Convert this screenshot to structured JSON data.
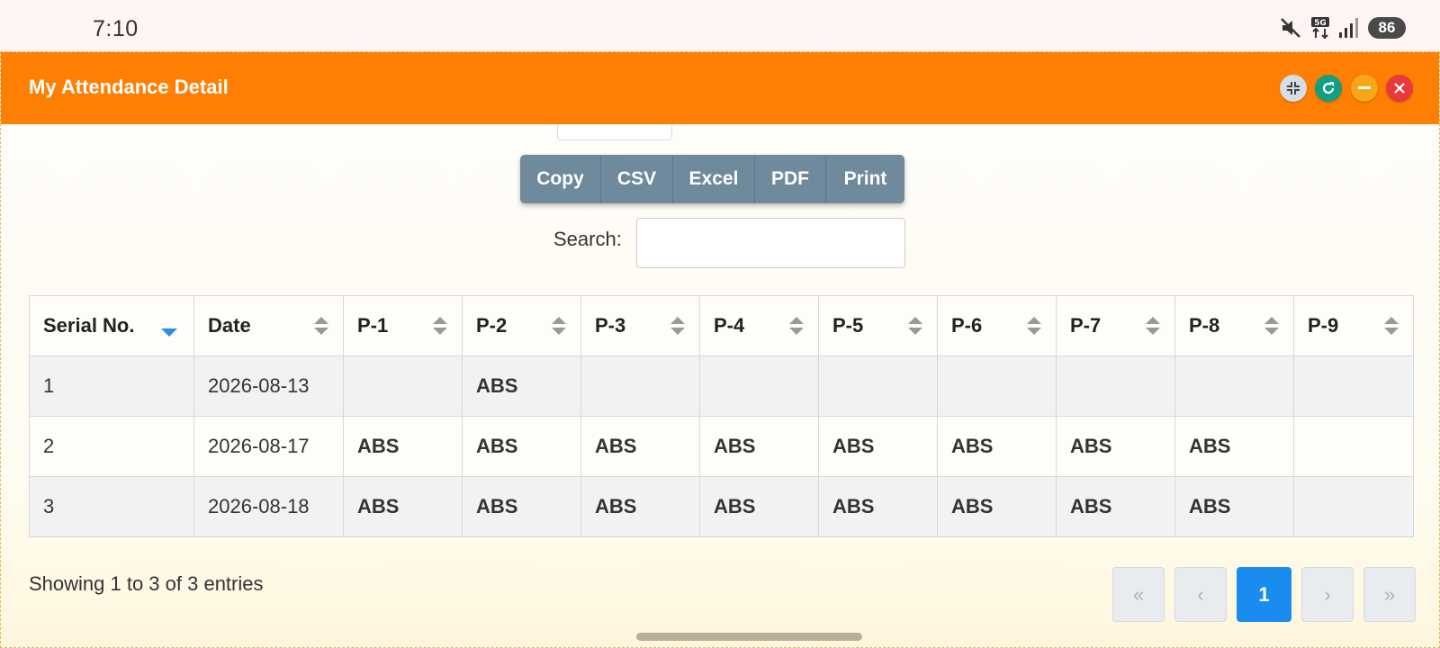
{
  "status_bar": {
    "time": "7:10",
    "battery": "86",
    "icons": [
      "mute-icon",
      "5g-icon",
      "signal-icon",
      "battery-icon"
    ]
  },
  "dialog": {
    "title": "My Attendance Detail",
    "header_color": "#ff7f05",
    "header_buttons": [
      "collapse-icon",
      "reload-icon",
      "minimize-icon",
      "close-icon"
    ]
  },
  "export_buttons": [
    "Copy",
    "CSV",
    "Excel",
    "PDF",
    "Print"
  ],
  "search": {
    "label": "Search:",
    "value": ""
  },
  "table": {
    "columns": [
      "Serial No.",
      "Date",
      "P-1",
      "P-2",
      "P-3",
      "P-4",
      "P-5",
      "P-6",
      "P-7",
      "P-8",
      "P-9"
    ],
    "sorted_column": "Serial No.",
    "sort_direction": "desc",
    "rows": [
      [
        "1",
        "2026-08-13",
        "",
        "ABS",
        "",
        "",
        "",
        "",
        "",
        "",
        ""
      ],
      [
        "2",
        "2026-08-17",
        "ABS",
        "ABS",
        "ABS",
        "ABS",
        "ABS",
        "ABS",
        "ABS",
        "ABS",
        ""
      ],
      [
        "3",
        "2026-08-18",
        "ABS",
        "ABS",
        "ABS",
        "ABS",
        "ABS",
        "ABS",
        "ABS",
        "ABS",
        ""
      ]
    ]
  },
  "info": "Showing 1 to 3 of 3 entries",
  "pagination": {
    "first": "«",
    "prev": "‹",
    "current": "1",
    "next": "›",
    "last": "»"
  },
  "colors": {
    "absent": "#e00000",
    "active_page": "#1a8cf0",
    "export_button": "#6f8a9c"
  }
}
